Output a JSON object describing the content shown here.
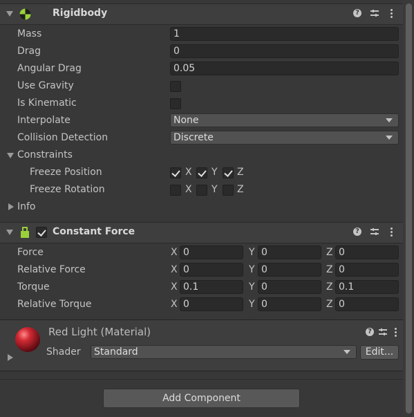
{
  "rigidbody": {
    "title": "Rigidbody",
    "fields": {
      "mass": {
        "label": "Mass",
        "value": "1"
      },
      "drag": {
        "label": "Drag",
        "value": "0"
      },
      "angular_drag": {
        "label": "Angular Drag",
        "value": "0.05"
      },
      "use_gravity": {
        "label": "Use Gravity",
        "checked": false
      },
      "is_kinematic": {
        "label": "Is Kinematic",
        "checked": false
      },
      "interpolate": {
        "label": "Interpolate",
        "value": "None"
      },
      "collision_detection": {
        "label": "Collision Detection",
        "value": "Discrete"
      }
    },
    "constraints": {
      "label": "Constraints",
      "freeze_position": {
        "label": "Freeze Position",
        "x": true,
        "y": true,
        "z": true
      },
      "freeze_rotation": {
        "label": "Freeze Rotation",
        "x": false,
        "y": false,
        "z": false
      }
    },
    "info_label": "Info"
  },
  "constant_force": {
    "title": "Constant Force",
    "enabled": true,
    "rows": [
      {
        "label": "Force",
        "x": "0",
        "y": "0",
        "z": "0"
      },
      {
        "label": "Relative Force",
        "x": "0",
        "y": "0",
        "z": "0"
      },
      {
        "label": "Torque",
        "x": "0.1",
        "y": "0",
        "z": "0.1"
      },
      {
        "label": "Relative Torque",
        "x": "0",
        "y": "0",
        "z": "0"
      }
    ]
  },
  "axis_labels": {
    "x": "X",
    "y": "Y",
    "z": "Z"
  },
  "material": {
    "title": "Red Light (Material)",
    "shader_label": "Shader",
    "shader_value": "Standard",
    "edit_label": "Edit..."
  },
  "add_component_label": "Add Component",
  "icons": {
    "help": "?"
  },
  "colors": {
    "background": "#383838",
    "header": "#3e3e3e",
    "field": "#2a2a2a",
    "material_sphere": "#c0202a"
  }
}
